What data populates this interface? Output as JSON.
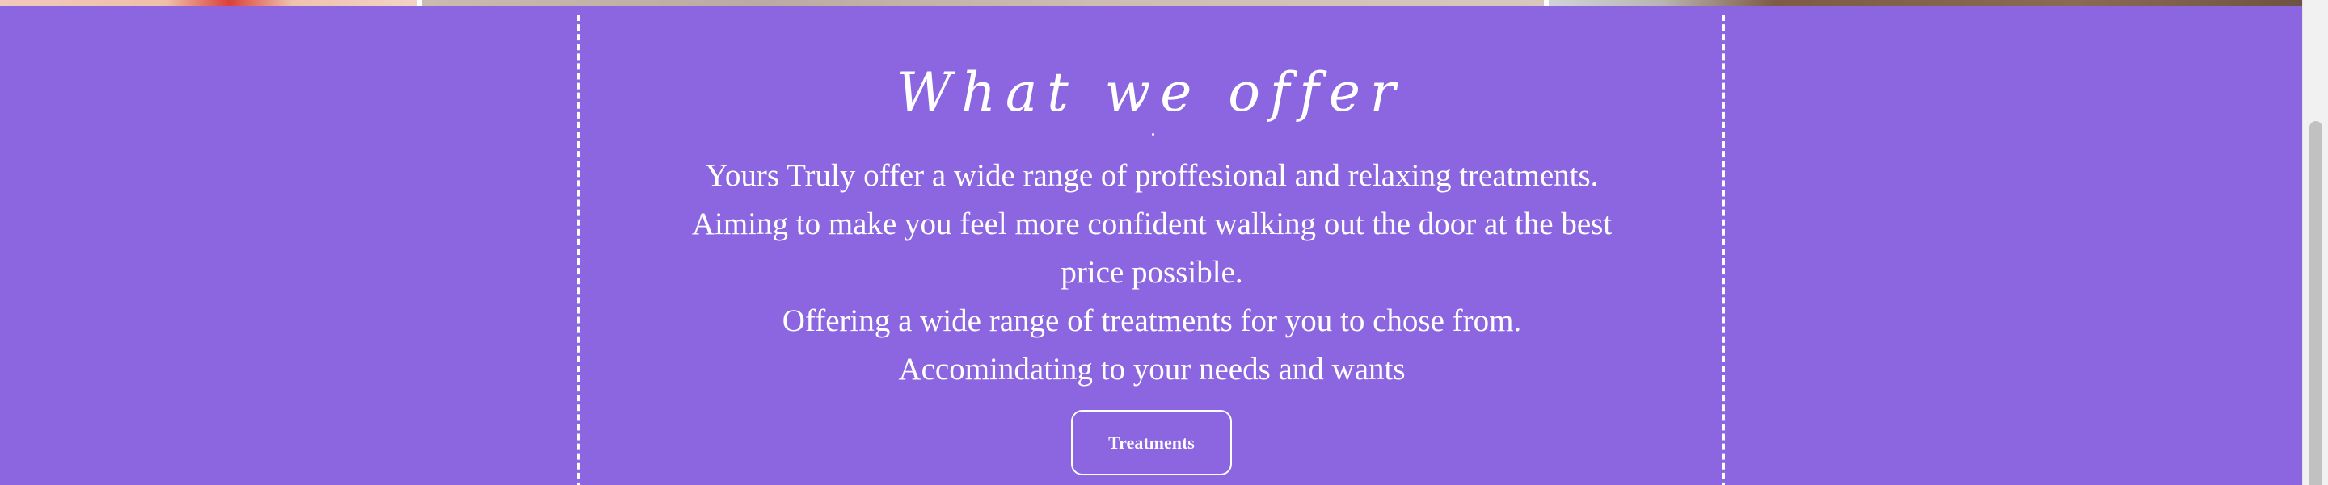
{
  "offer": {
    "title": "What we offer",
    "paragraphs": [
      "Yours Truly offer a wide range of proffesional and relaxing treatments.",
      "Aiming to make you feel more confident walking out the door at the best price possible.",
      "Offering a wide range of treatments for you to chose from.",
      "Accomindating to your needs and wants"
    ],
    "button_label": "Treatments"
  },
  "colors": {
    "section_background": "#8b66e0",
    "text": "#ffffff",
    "scrollbar_track": "#f1f1f1",
    "scrollbar_thumb": "#c1c1c1"
  }
}
